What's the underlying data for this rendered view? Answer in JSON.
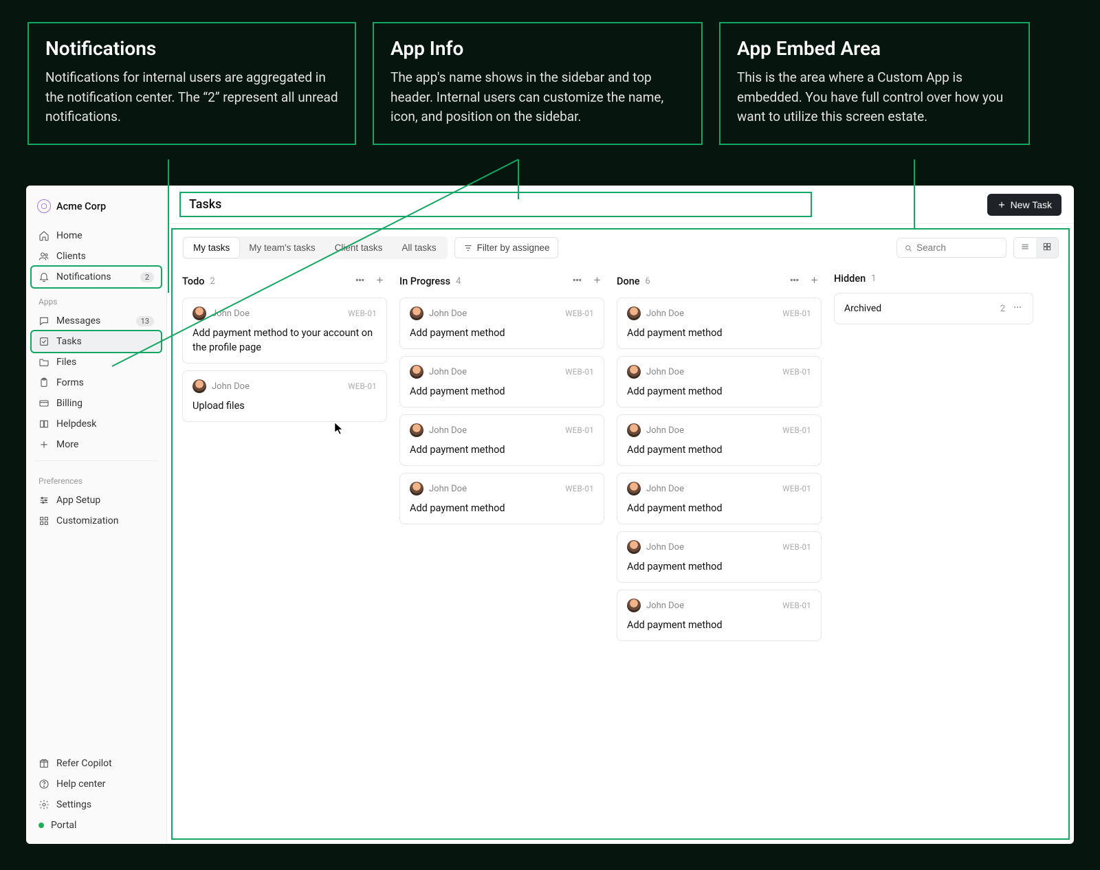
{
  "callouts": {
    "notifications": {
      "title": "Notifications",
      "body": "Notifications for internal users are aggregated in the notification center. The “2” represent all unread notifications."
    },
    "app_info": {
      "title": "App Info",
      "body": "The app's name shows in the sidebar and top header. Internal users can customize the name, icon, and position on the sidebar."
    },
    "embed": {
      "title": "App Embed Area",
      "body": "This is the area where a Custom App is embedded. You have full control over how you want to utilize this screen estate."
    }
  },
  "sidebar": {
    "brand": "Acme Corp",
    "nav": {
      "home": "Home",
      "clients": "Clients",
      "notifications": {
        "label": "Notifications",
        "badge": "2"
      }
    },
    "section_apps": "Apps",
    "apps": {
      "messages": {
        "label": "Messages",
        "badge": "13"
      },
      "tasks": "Tasks",
      "files": "Files",
      "forms": "Forms",
      "billing": "Billing",
      "helpdesk": "Helpdesk",
      "more": "More"
    },
    "section_prefs": "Preferences",
    "prefs": {
      "app_setup": "App Setup",
      "customization": "Customization"
    },
    "footer": {
      "refer": "Refer Copilot",
      "help": "Help center",
      "settings": "Settings",
      "portal": "Portal"
    }
  },
  "header": {
    "title": "Tasks",
    "new_task": "New Task"
  },
  "controls": {
    "tabs": [
      "My tasks",
      "My team's tasks",
      "Client tasks",
      "All tasks"
    ],
    "selected_tab_index": 0,
    "filter": "Filter by assignee",
    "search_placeholder": "Search"
  },
  "board": {
    "columns": [
      {
        "title": "Todo",
        "count": "2",
        "cards": [
          {
            "user": "John Doe",
            "code": "WEB-01",
            "title": "Add payment method to your account on the profile page"
          },
          {
            "user": "John Doe",
            "code": "WEB-01",
            "title": "Upload files"
          }
        ]
      },
      {
        "title": "In Progress",
        "count": "4",
        "cards": [
          {
            "user": "John Doe",
            "code": "WEB-01",
            "title": "Add payment method"
          },
          {
            "user": "John Doe",
            "code": "WEB-01",
            "title": "Add payment method"
          },
          {
            "user": "John Doe",
            "code": "WEB-01",
            "title": "Add payment method"
          },
          {
            "user": "John Doe",
            "code": "WEB-01",
            "title": "Add payment method"
          }
        ]
      },
      {
        "title": "Done",
        "count": "6",
        "cards": [
          {
            "user": "John Doe",
            "code": "WEB-01",
            "title": "Add payment method"
          },
          {
            "user": "John Doe",
            "code": "WEB-01",
            "title": "Add payment method"
          },
          {
            "user": "John Doe",
            "code": "WEB-01",
            "title": "Add payment method"
          },
          {
            "user": "John Doe",
            "code": "WEB-01",
            "title": "Add payment method"
          },
          {
            "user": "John Doe",
            "code": "WEB-01",
            "title": "Add payment method"
          },
          {
            "user": "John Doe",
            "code": "WEB-01",
            "title": "Add payment method"
          }
        ]
      }
    ],
    "hidden": {
      "title": "Hidden",
      "count": "1",
      "row_label": "Archived",
      "row_count": "2"
    }
  }
}
